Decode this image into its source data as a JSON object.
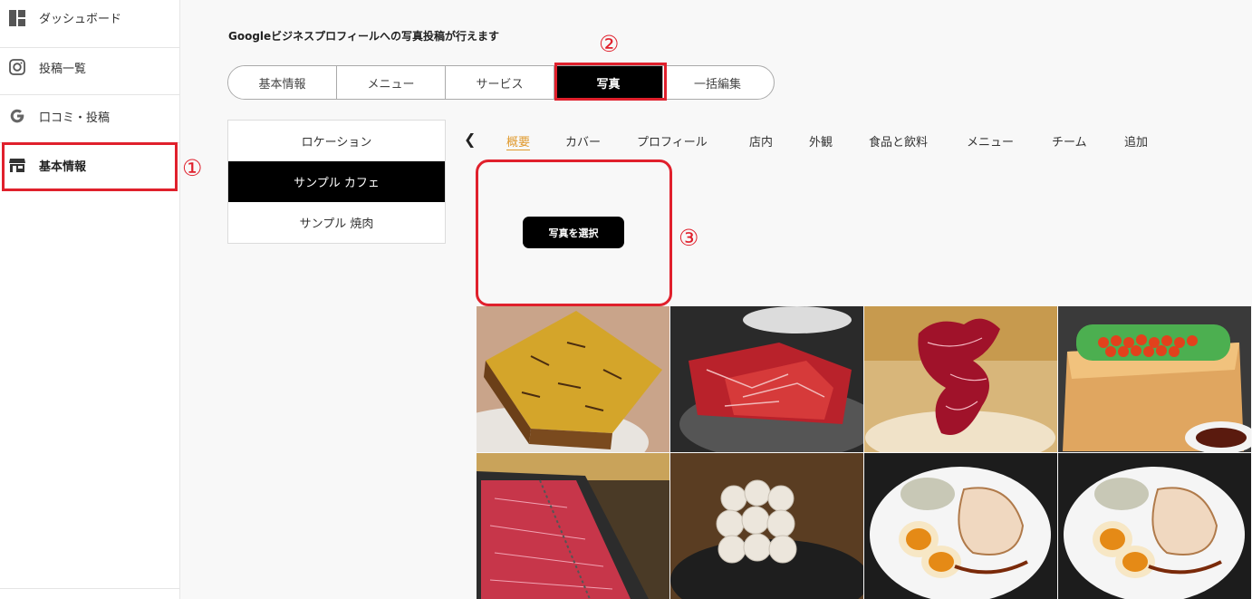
{
  "sidebar": {
    "items": [
      {
        "label": "ダッシュボード",
        "icon": "dashboard-icon"
      },
      {
        "label": "投稿一覧",
        "icon": "instagram-icon"
      },
      {
        "label": "口コミ・投稿",
        "icon": "google-icon"
      },
      {
        "label": "基本情報",
        "icon": "store-icon"
      }
    ]
  },
  "annotations": {
    "step1": "①",
    "step2": "②",
    "step3": "③",
    "color": "#e0202c"
  },
  "header": {
    "text": "Googleビジネスプロフィールへの写真投稿が行えます"
  },
  "main_tabs": [
    "基本情報",
    "メニュー",
    "サービス",
    "写真",
    "一括編集"
  ],
  "locations": {
    "header": "ロケーション",
    "items": [
      "サンプル カフェ",
      "サンプル 焼肉"
    ]
  },
  "photo_tabs": {
    "prev_icon": "❮",
    "items": [
      "概要",
      "カバー",
      "プロフィール",
      "店内",
      "外観",
      "食品と飲料",
      "メニュー",
      "チーム",
      "追加"
    ]
  },
  "select_button": "写真を選択",
  "photos": [
    {
      "name": "cake-photo"
    },
    {
      "name": "beef-platter-photo"
    },
    {
      "name": "beef-tower-photo"
    },
    {
      "name": "ikura-box-photo"
    },
    {
      "name": "beef-slices-photo"
    },
    {
      "name": "white-dessert-photo"
    },
    {
      "name": "ramen-plate-photo-1"
    },
    {
      "name": "ramen-plate-photo-2"
    }
  ]
}
